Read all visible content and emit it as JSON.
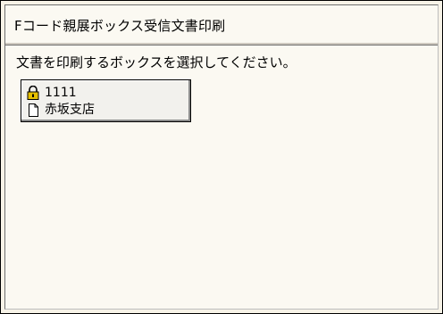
{
  "header": {
    "title": "Fコード親展ボックス受信文書印刷"
  },
  "main": {
    "instruction": "文書を印刷するボックスを選択してください。",
    "boxes": [
      {
        "number": "1111",
        "name": "赤坂支店",
        "icons": [
          "lock-icon",
          "document-icon"
        ]
      }
    ]
  },
  "colors": {
    "background": "#fbf9f2",
    "lock_icon": "#e6c000",
    "border": "#000000"
  }
}
